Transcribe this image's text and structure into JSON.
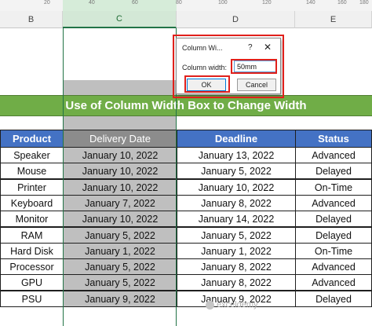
{
  "ruler": {
    "labels": [
      "20",
      "40",
      "60",
      "80",
      "100",
      "120",
      "140",
      "160",
      "180"
    ]
  },
  "column_headers": {
    "b": "B",
    "c": "C",
    "d": "D",
    "e": "E"
  },
  "title_row": "Use of Column Width Box to Change Width",
  "table": {
    "headers": [
      "Product",
      "Delivery  Date",
      "Deadline",
      "Status"
    ],
    "rows": [
      [
        "Speaker",
        "January 10, 2022",
        "January 13, 2022",
        "Advanced"
      ],
      [
        "Mouse",
        "January 10, 2022",
        "January 5, 2022",
        "Delayed"
      ],
      [
        "Printer",
        "January 10, 2022",
        "January 10, 2022",
        "On-Time"
      ],
      [
        "Keyboard",
        "January 7, 2022",
        "January 8, 2022",
        "Advanced"
      ],
      [
        "Monitor",
        "January 10, 2022",
        "January 14, 2022",
        "Delayed"
      ],
      [
        "RAM",
        "January 5, 2022",
        "January 5, 2022",
        "Delayed"
      ],
      [
        "Hard Disk",
        "January 1, 2022",
        "January 1, 2022",
        "On-Time"
      ],
      [
        "Processor",
        "January 5, 2022",
        "January 8, 2022",
        "Advanced"
      ],
      [
        "GPU",
        "January 5, 2022",
        "January 8, 2022",
        "Advanced"
      ],
      [
        "PSU",
        "January 9, 2022",
        "January 9, 2022",
        "Delayed"
      ]
    ]
  },
  "dialog": {
    "title": "Column Wi...",
    "help": "?",
    "close": "✕",
    "label": "Column width:",
    "value": "50mm",
    "ok": "OK",
    "cancel": "Cancel"
  },
  "watermark": "exceldemy",
  "colors": {
    "title_green": "#70ad47",
    "header_blue": "#4472c4",
    "selected_gray": "#bfbfbf",
    "highlight_red": "#e0201b"
  }
}
